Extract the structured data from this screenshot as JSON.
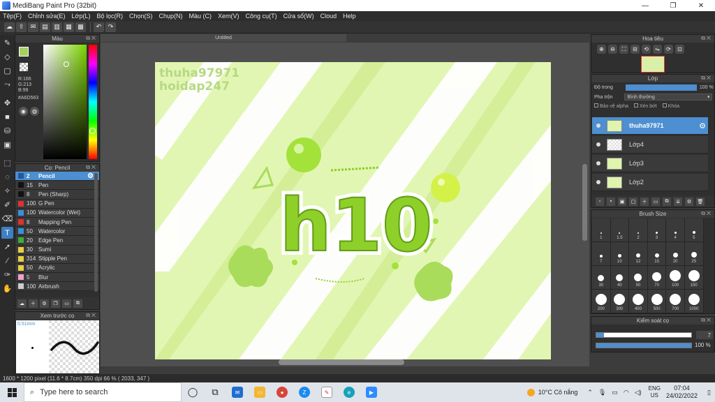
{
  "window": {
    "title": "MediBang Paint Pro (32bit)",
    "controls": [
      "—",
      "❐",
      "✕"
    ]
  },
  "menu": [
    "Tệp(F)",
    "Chỉnh sửa(E)",
    "Lớp(L)",
    "Bộ lọc(R)",
    "Chọn(S)",
    "Chụp(N)",
    "Màu (C)",
    "Xem(V)",
    "Công cụ(T)",
    "Cửa sổ(W)",
    "Cloud",
    "Help"
  ],
  "color_panel": {
    "title": "Màu",
    "rgb": {
      "r": "R:166",
      "g": "G:213",
      "b": "B:99"
    },
    "hex": "#A6D563",
    "fg_color": "#a6d563",
    "bg_color": "#ffffff"
  },
  "brush_panel": {
    "title": "Cọ: Pencil",
    "items": [
      {
        "size": "2",
        "name": "Pencil",
        "color": "#1f5a9b",
        "active": true
      },
      {
        "size": "15",
        "name": "Pen",
        "color": "#111111"
      },
      {
        "size": "8",
        "name": "Pen (Sharp)",
        "color": "#111111"
      },
      {
        "size": "100",
        "name": "G Pen",
        "color": "#e03030"
      },
      {
        "size": "100",
        "name": "Watercolor (Wet)",
        "color": "#3b8ee0"
      },
      {
        "size": "8",
        "name": "Mapping Pen",
        "color": "#e03030"
      },
      {
        "size": "50",
        "name": "Watercolor",
        "color": "#3b8ee0"
      },
      {
        "size": "20",
        "name": "Edge Pen",
        "color": "#38b038"
      },
      {
        "size": "30",
        "name": "Sumi",
        "color": "#e8d040"
      },
      {
        "size": "314",
        "name": "Stipple Pen",
        "color": "#e8d040"
      },
      {
        "size": "50",
        "name": "Acrylic",
        "color": "#e8d040"
      },
      {
        "size": "5",
        "name": "Blur",
        "color": "#f0a0d0"
      },
      {
        "size": "100",
        "name": "Airbrush",
        "color": "#cccccc"
      }
    ]
  },
  "preview_panel": {
    "title": "Xem trước cọ",
    "size": "0.51mm"
  },
  "document": {
    "tab": "Untitled",
    "watermark1": "thuha97971",
    "watermark2": "hoidap247",
    "art_text": "h10"
  },
  "status": "1600 * 1200 pixel   (11.6 * 8.7cm)   350 dpi   66 %   ( 2033, 347 )",
  "navigator": {
    "title": "Hoa tiêu"
  },
  "layer_panel": {
    "title": "Lớp",
    "opacity_label": "Độ trong",
    "opacity_value": "100 %",
    "blend_label": "Pha trộn",
    "blend_value": "Bình thường",
    "check_alpha": "Bảo vệ alpha",
    "check_clip": "Xén bớt",
    "check_lock": "Khóa",
    "layers": [
      {
        "name": "thuha97971",
        "active": true,
        "art": true
      },
      {
        "name": "Lớp4",
        "active": false,
        "art": false
      },
      {
        "name": "Lớp3",
        "active": false,
        "art": true
      },
      {
        "name": "Lớp2",
        "active": false,
        "art": true
      }
    ]
  },
  "brush_size": {
    "title": "Brush Size",
    "sizes": [
      "1",
      "1.5",
      "2",
      "3",
      "4",
      "5",
      "7",
      "10",
      "12",
      "15",
      "20",
      "25",
      "30",
      "40",
      "50",
      "70",
      "100",
      "150",
      "200",
      "300",
      "400",
      "500",
      "700",
      "1000"
    ]
  },
  "brush_control": {
    "title": "Kiểm soát cọ",
    "size_value": "7",
    "size_fraction": 0.08,
    "opacity_value": "100 %",
    "opacity_fraction": 1.0
  },
  "taskbar": {
    "search_placeholder": "Type here to search",
    "weather": "10°C  Cô nắng",
    "lang1": "ENG",
    "lang2": "US",
    "time": "07:04",
    "date": "24/02/2022"
  }
}
